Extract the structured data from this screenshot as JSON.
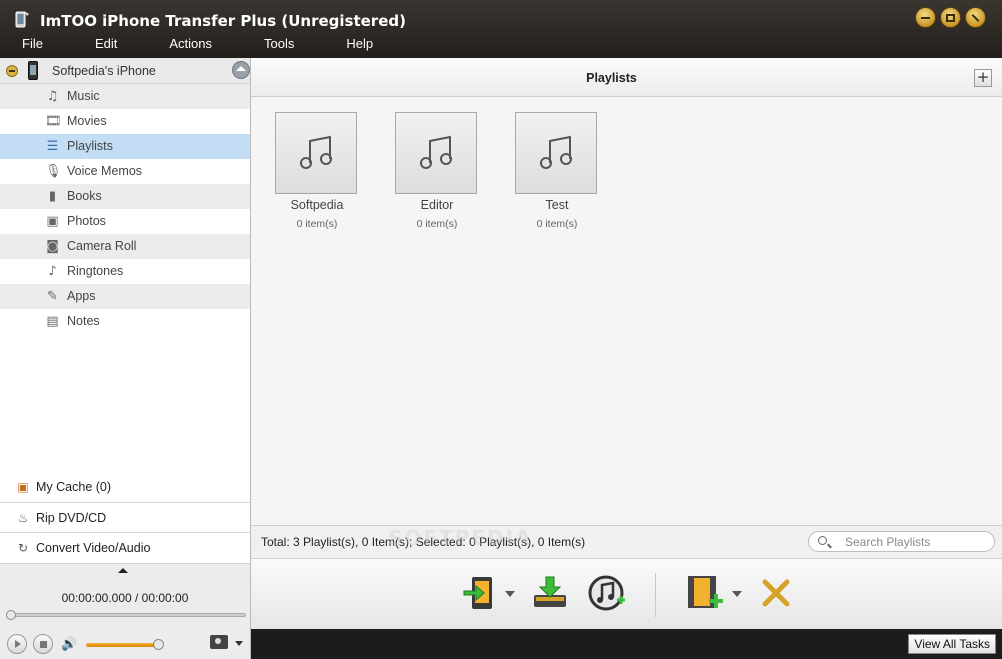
{
  "window": {
    "title": "ImTOO iPhone Transfer Plus (Unregistered)"
  },
  "menu": [
    "File",
    "Edit",
    "Actions",
    "Tools",
    "Help"
  ],
  "sidebar": {
    "device_name": "Softpedia's iPhone",
    "items": [
      {
        "label": "Music",
        "icon": "music-note-icon"
      },
      {
        "label": "Movies",
        "icon": "film-icon"
      },
      {
        "label": "Playlists",
        "icon": "playlist-icon",
        "selected": true
      },
      {
        "label": "Voice Memos",
        "icon": "microphone-icon"
      },
      {
        "label": "Books",
        "icon": "book-icon"
      },
      {
        "label": "Photos",
        "icon": "photo-icon"
      },
      {
        "label": "Camera Roll",
        "icon": "camera-icon"
      },
      {
        "label": "Ringtones",
        "icon": "ringtone-icon"
      },
      {
        "label": "Apps",
        "icon": "apps-icon"
      },
      {
        "label": "Notes",
        "icon": "notes-icon"
      }
    ],
    "tasks": [
      {
        "label": "My Cache (0)",
        "icon": "cache-icon"
      },
      {
        "label": "Rip DVD/CD",
        "icon": "flame-icon"
      },
      {
        "label": "Convert Video/Audio",
        "icon": "convert-icon"
      }
    ]
  },
  "player": {
    "time": "00:00:00.000 / 00:00:00",
    "volume_fraction": 0.9
  },
  "main": {
    "title": "Playlists",
    "playlists": [
      {
        "name": "Softpedia",
        "count": "0 item(s)"
      },
      {
        "name": "Editor",
        "count": "0 item(s)"
      },
      {
        "name": "Test",
        "count": "0 item(s)"
      }
    ],
    "status": "Total: 3 Playlist(s), 0 Item(s); Selected: 0 Playlist(s), 0 Item(s)",
    "search_placeholder": "Search Playlists",
    "watermark": "SOFTPEDIA"
  },
  "footer": {
    "view_all_label": "View All Tasks"
  },
  "colors": {
    "titlebar": "#2b2622",
    "selection": "#c3ddf5",
    "accent_gold": "#d6a22a",
    "green": "#3dbb3a"
  }
}
